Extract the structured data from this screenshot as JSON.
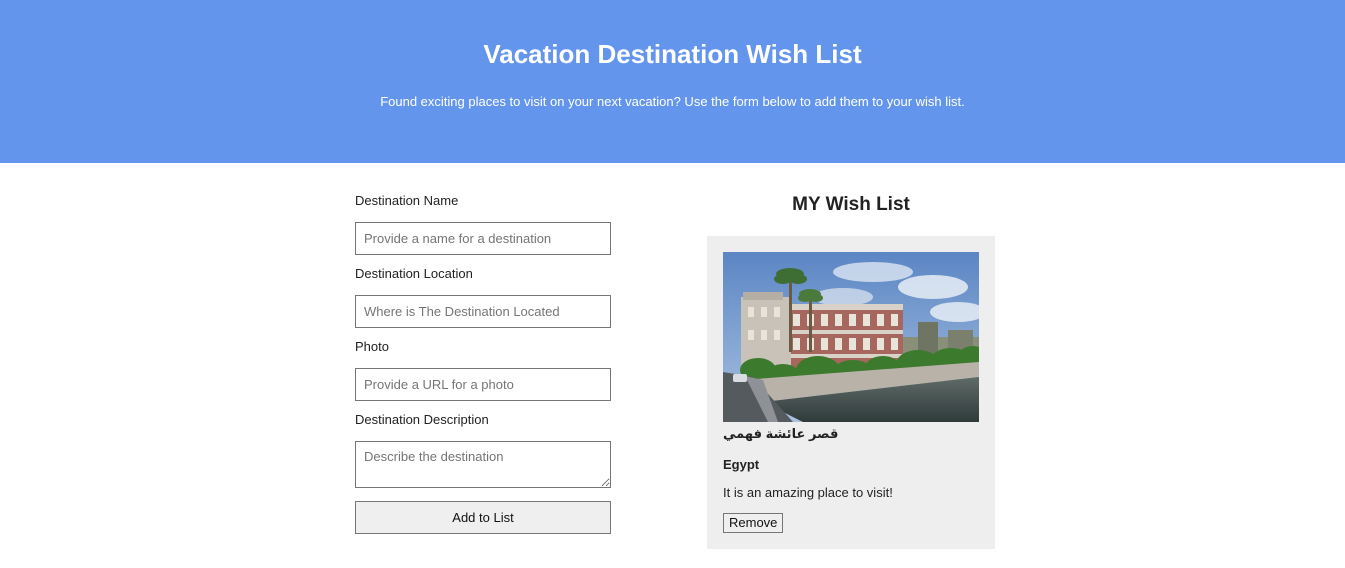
{
  "header": {
    "title": "Vacation Destination Wish List",
    "subtitle": "Found exciting places to visit on your next vacation? Use the form below to add them to your wish list."
  },
  "form": {
    "name_label": "Destination Name",
    "name_placeholder": "Provide a name for a destination",
    "location_label": "Destination Location",
    "location_placeholder": "Where is The Destination Located",
    "photo_label": "Photo",
    "photo_placeholder": "Provide a URL for a photo",
    "description_label": "Destination Description",
    "description_placeholder": "Describe the destination",
    "submit_label": "Add to List"
  },
  "wishlist": {
    "title": "MY Wish List",
    "cards": [
      {
        "name": "قصر عائشة فهمي",
        "location": "Egypt",
        "description": "It is an amazing place to visit!",
        "remove_label": "Remove"
      }
    ]
  },
  "colors": {
    "header_bg": "#6495ed",
    "card_bg": "#eeeeee"
  }
}
